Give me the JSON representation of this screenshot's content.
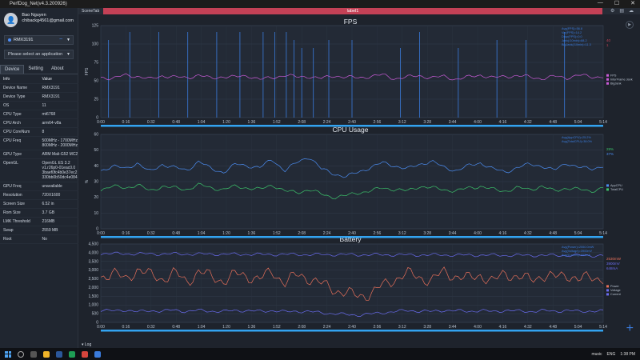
{
  "window": {
    "title": "PerfDog_Net(v4.3.200926)",
    "controls": [
      "—",
      "☐",
      "✕"
    ]
  },
  "user": {
    "name": "Bao Nguyen",
    "email": "chibackg4561@gmail.com"
  },
  "device_select": {
    "value": "RMX3191"
  },
  "app_select": {
    "placeholder": "Please select an application"
  },
  "tabs": [
    {
      "label": "Device"
    },
    {
      "label": "Setting"
    },
    {
      "label": "About"
    }
  ],
  "info": {
    "headers": {
      "key": "Info",
      "value": "Value"
    },
    "rows": [
      {
        "k": "Device Name",
        "v": "RMX3191"
      },
      {
        "k": "Device Type",
        "v": "RMX3191"
      },
      {
        "k": "OS",
        "v": "11"
      },
      {
        "k": "CPU Type",
        "v": "mt6768"
      },
      {
        "k": "CPU Arch",
        "v": "arm64-v8a"
      },
      {
        "k": "CPU CoreNum",
        "v": "8"
      },
      {
        "k": "CPU Freq",
        "v": "500MHz - 1700MHz 800MHz - 2000MHz"
      },
      {
        "k": "GPU Type",
        "v": "ARM Mali-G52 MC2"
      },
      {
        "k": "OpenGL",
        "v": "OpenGL ES 3.2 v1.r26p0-01eac0.0 3baef0fc4b0e37ec2 330bb0b50dc4e084"
      },
      {
        "k": "GPU Freq",
        "v": "unavailable"
      },
      {
        "k": "Resolution",
        "v": "720X1600"
      },
      {
        "k": "Screen Size",
        "v": "6.52 in"
      },
      {
        "k": "Rom Size",
        "v": "3.7 GB"
      },
      {
        "k": "LMK Threshold",
        "v": "216MB"
      },
      {
        "k": "Swap",
        "v": "2559 MB"
      },
      {
        "k": "Root",
        "v": "No"
      }
    ]
  },
  "topbar": {
    "scene_tab": "SceneTab",
    "label": "label1"
  },
  "colors": {
    "fps": "#c85ad6",
    "jank": "#3a7bdc",
    "app_cpu": "#4b8cf0",
    "total_cpu": "#3cc46b",
    "power": "#e8705a",
    "voltage": "#6a6cf0",
    "accent_bar": "#c44156"
  },
  "time_ticks": [
    "0:00",
    "0:16",
    "0:32",
    "0:48",
    "1:04",
    "1:20",
    "1:36",
    "1:52",
    "2:08",
    "2:24",
    "2:40",
    "2:56",
    "3:12",
    "3:28",
    "3:44",
    "4:00",
    "4:16",
    "4:32",
    "4:48",
    "5:04",
    "5:14"
  ],
  "chart_data": [
    {
      "type": "line",
      "title": "FPS",
      "ylabel": "FPS",
      "ylim": [
        0,
        125
      ],
      "yticks": [
        "0",
        "25",
        "50",
        "75",
        "100",
        "125"
      ],
      "legend": [
        "FPS",
        "InterFrame Jank",
        "BigJank"
      ],
      "stats": [
        "Avg(FPS)=56.8",
        "Var(FPS)=14.2",
        "Drop(FPS)=0.0",
        "Jank(/10min)=88.2",
        "BigJank(/10min)=11.3"
      ],
      "current_values": [
        "40",
        "1"
      ],
      "series": [
        {
          "name": "FPS",
          "values": [
            55,
            53,
            58,
            56,
            52,
            57,
            55,
            54,
            58,
            53,
            56,
            55,
            57,
            52,
            54,
            58,
            55,
            56,
            53,
            57,
            55,
            54,
            56,
            58,
            53,
            55,
            57,
            54,
            56,
            52,
            55,
            58,
            54,
            56,
            57,
            55,
            53,
            56,
            54,
            58,
            55,
            56
          ]
        }
      ],
      "spikes": [
        4,
        15,
        30,
        45,
        60,
        72,
        84,
        90,
        96,
        100,
        104,
        110,
        118,
        130,
        155,
        165,
        185,
        205,
        220,
        240
      ]
    },
    {
      "type": "line",
      "title": "CPU Usage",
      "ylabel": "%",
      "ylim": [
        0,
        60
      ],
      "yticks": [
        "0",
        "10",
        "20",
        "30",
        "40",
        "50",
        "60"
      ],
      "legend": [
        "AppCPU",
        "TotalCPU"
      ],
      "stats": [
        "Avg(AppCPU)=25.2%",
        "Avg(TotalCPU)=38.0%"
      ],
      "current_values": [
        "28%",
        "37%"
      ],
      "series": [
        {
          "name": "AppCPU",
          "values": [
            37,
            40,
            38,
            42,
            36,
            41,
            39,
            37,
            43,
            38,
            36,
            41,
            40,
            39,
            44,
            37,
            42,
            46,
            38,
            35,
            33,
            36,
            39,
            42,
            40,
            38,
            41,
            43,
            39,
            37,
            40,
            42,
            38,
            36,
            39,
            41,
            40,
            37,
            42,
            39,
            38,
            40
          ]
        },
        {
          "name": "TotalCPU",
          "values": [
            25,
            27,
            26,
            28,
            24,
            27,
            26,
            25,
            28,
            26,
            25,
            27,
            26,
            25,
            28,
            24,
            23,
            25,
            22,
            20,
            21,
            23,
            24,
            26,
            25,
            24,
            27,
            26,
            25,
            24,
            26,
            27,
            25,
            24,
            26,
            25,
            27,
            24,
            26,
            25,
            24,
            26
          ]
        }
      ]
    },
    {
      "type": "line",
      "title": "Battery",
      "ylabel": "",
      "ylim": [
        0,
        4500
      ],
      "yticks": [
        "0",
        "500",
        "1,000",
        "1,500",
        "2,000",
        "2,500",
        "3,000",
        "3,500",
        "4,000",
        "4,500"
      ],
      "legend": [
        "Power",
        "Voltage",
        "Current"
      ],
      "stats": [
        "Avg(Power)=2550.0mW",
        "Avg(Voltage)=3900mV",
        "Avg(Current)=653mA"
      ],
      "current_values": [
        "2530mW",
        "3900mV",
        "648mA"
      ],
      "series": [
        {
          "name": "Power",
          "values": [
            2600,
            2900,
            2400,
            3100,
            2700,
            2500,
            2850,
            2300,
            2950,
            2600,
            2400,
            2750,
            2650,
            2500,
            2900,
            2300,
            2700,
            2550,
            2200,
            1900,
            1700,
            1500,
            1650,
            2100,
            2500,
            2800,
            2600,
            2400,
            2900,
            2650,
            2500,
            2750,
            2300,
            2850,
            2600,
            2450,
            2700,
            2550,
            2800,
            2400,
            2650,
            2500
          ]
        },
        {
          "name": "Voltage",
          "values": [
            3950,
            3950,
            3940,
            3940,
            3930,
            3930,
            3930,
            3920,
            3920,
            3920,
            3910,
            3910,
            3910,
            3900,
            3900,
            3900,
            3900,
            3890,
            3890,
            3890,
            3890,
            3880,
            3880,
            3880,
            3880,
            3870,
            3870,
            3870,
            3870,
            3860,
            3860,
            3860,
            3860,
            3850,
            3850,
            3850,
            3850,
            3850,
            3840,
            3840,
            3840,
            3840
          ]
        },
        {
          "name": "Current",
          "values": [
            700,
            650,
            720,
            600,
            680,
            640,
            710,
            630,
            690,
            650,
            620,
            700,
            660,
            640,
            680,
            600,
            650,
            610,
            560,
            500,
            450,
            420,
            480,
            560,
            620,
            680,
            650,
            620,
            700,
            660,
            640,
            680,
            620,
            690,
            650,
            630,
            670,
            640,
            690,
            620,
            660,
            640
          ]
        }
      ]
    }
  ]
}
